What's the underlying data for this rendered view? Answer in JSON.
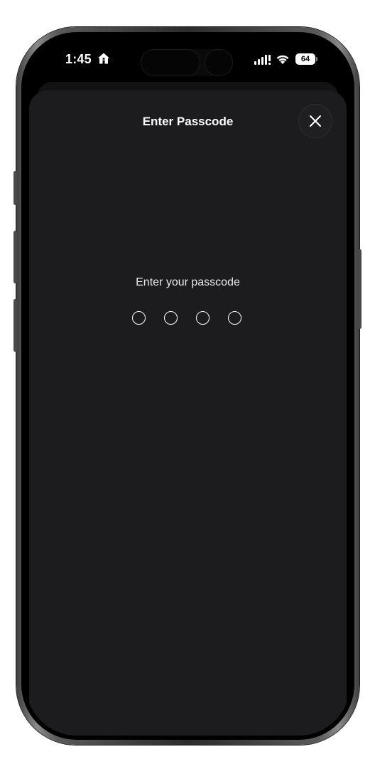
{
  "status_bar": {
    "time": "1:45",
    "home_icon": "home-icon",
    "signal_icon": "cellular-signal-icon",
    "wifi_icon": "wifi-icon",
    "battery_level": "64"
  },
  "passcode_sheet": {
    "title": "Enter Passcode",
    "close_icon": "close-icon",
    "prompt": "Enter your passcode",
    "digits_total": 4,
    "digits_entered": 0
  },
  "colors": {
    "sheet_background": "#1c1c1e",
    "screen_background": "#000000",
    "text": "#ffffff"
  }
}
